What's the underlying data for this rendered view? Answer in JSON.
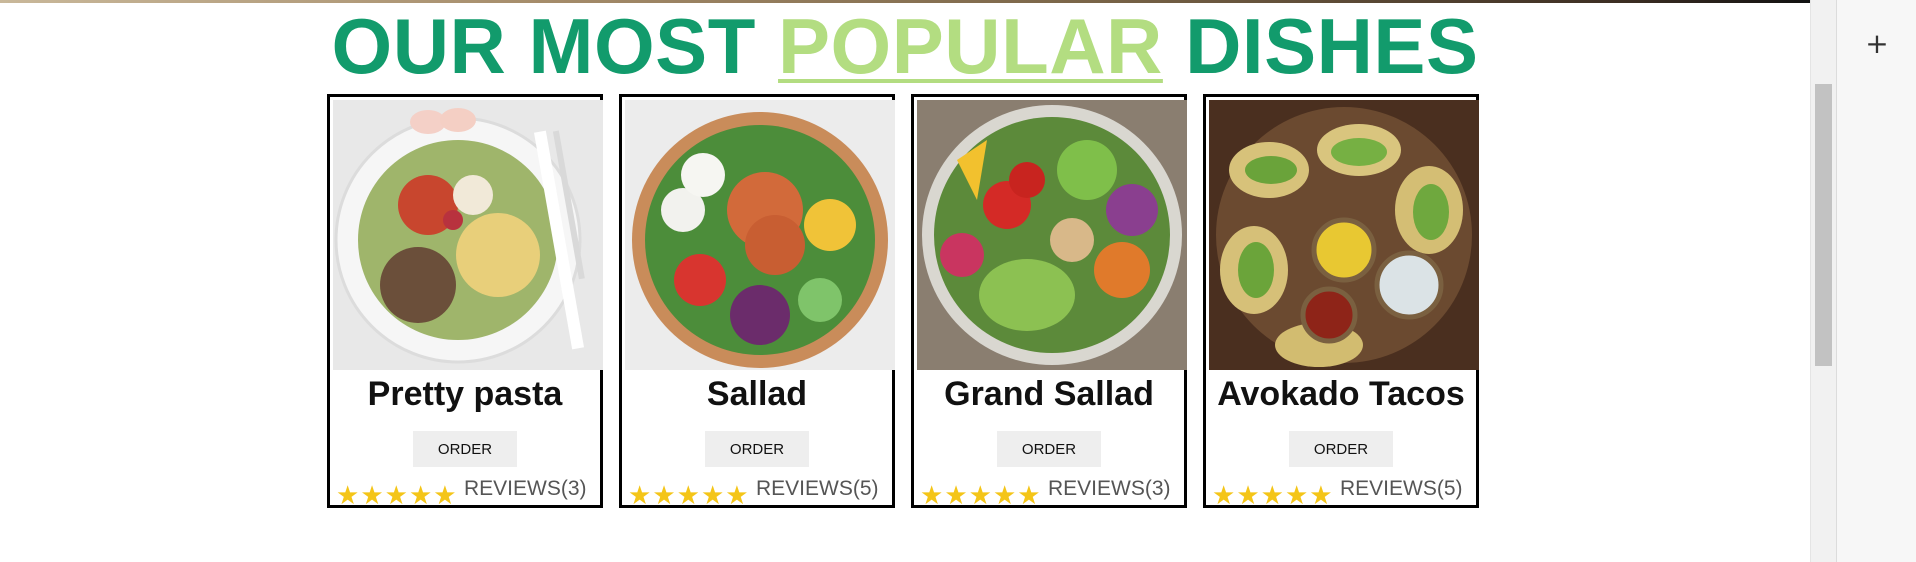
{
  "heading": {
    "part1": "OUR MOST",
    "accent": "POPULAR",
    "part2": "DISHES"
  },
  "colors": {
    "heading": "#129b6c",
    "accent": "#b3dd81",
    "star": "#f4c518"
  },
  "dishes": [
    {
      "name": "Pretty pasta",
      "order_label": "ORDER",
      "rating": 5,
      "reviews": "REVIEWS(3)"
    },
    {
      "name": "Sallad",
      "order_label": "ORDER",
      "rating": 5,
      "reviews": "REVIEWS(5)"
    },
    {
      "name": "Grand Sallad",
      "order_label": "ORDER",
      "rating": 5,
      "reviews": "REVIEWS(3)"
    },
    {
      "name": "Avokado Tacos",
      "order_label": "ORDER",
      "rating": 5,
      "reviews": "REVIEWS(5)"
    }
  ],
  "side_panel": {
    "add_label": "+"
  }
}
